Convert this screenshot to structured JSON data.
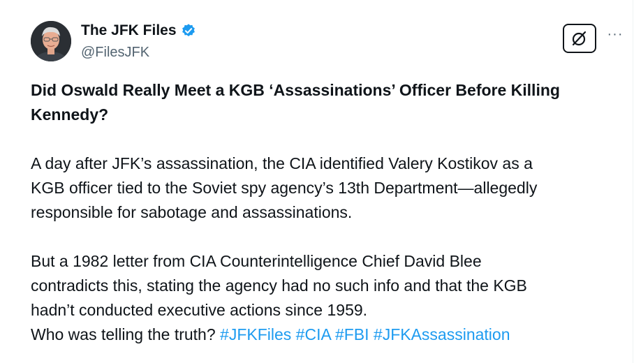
{
  "author": {
    "display_name": "The JFK Files",
    "handle": "@FilesJFK",
    "verified": true,
    "verified_color": "#1d9bf0",
    "avatar_icon": "avatar-photo"
  },
  "actions": {
    "grok_icon": "grok-icon",
    "more_label": "···"
  },
  "post": {
    "headline_line1": "Did Oswald Really Meet a KGB ‘Assassinations’ Officer Before Killing",
    "headline_line2": "Kennedy?",
    "para1_line1": "A day after JFK’s assassination, the CIA identified Valery Kostikov as a",
    "para1_line2": "KGB officer tied to the Soviet spy agency’s 13th Department—allegedly",
    "para1_line3": "responsible for sabotage and assassinations.",
    "para2_line1": "But a 1982 letter from CIA Counterintelligence Chief David Blee",
    "para2_line2": "contradicts this, stating the agency had no such info and that the KGB",
    "para2_line3": "hadn’t conducted executive actions since 1959.",
    "para2_line4": "Who was telling the truth?",
    "hashtags": [
      "#JFKFiles",
      "#CIA",
      "#FBI",
      "#JFKAssassination"
    ]
  },
  "colors": {
    "text": "#0f1419",
    "secondary": "#536471",
    "link": "#1d9bf0"
  }
}
